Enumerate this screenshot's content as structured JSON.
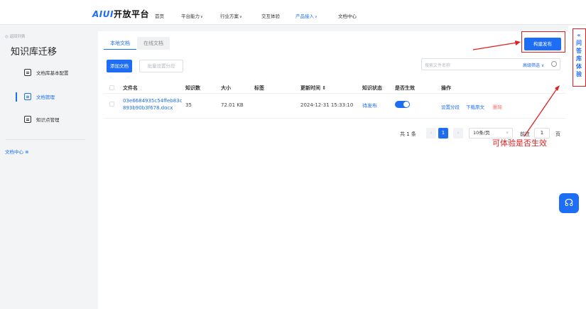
{
  "header": {
    "logo_prefix": "AIUI",
    "logo_text": "开放平台",
    "nav": [
      {
        "label": "首页"
      },
      {
        "label": "平台能力",
        "chevron": "chevron-down-icon"
      },
      {
        "label": "行业方案",
        "chevron": "chevron-down-icon"
      },
      {
        "label": "交互体验"
      },
      {
        "label": "产品接入",
        "chevron": "chevron-down-icon",
        "active": true
      },
      {
        "label": "文档中心"
      }
    ]
  },
  "sidebar": {
    "back_label": "◎ 返回列表",
    "title": "知识库迁移",
    "items": [
      {
        "label": "文档库基本配置",
        "icon": "config-doc-icon"
      },
      {
        "label": "文档管理",
        "icon": "doc-manage-icon",
        "active": true
      },
      {
        "label": "知识点管理",
        "icon": "book-icon"
      }
    ],
    "doc_center_label": "文档中心 ⊗"
  },
  "main": {
    "tabs": [
      {
        "label": "本地文档",
        "active": true
      },
      {
        "label": "在线文档"
      }
    ],
    "add_button": "添加文档",
    "batch_button": "批量设置分段",
    "build_button": "构建发布",
    "help_icon": "?",
    "search": {
      "placeholder": "搜索文件名称",
      "advanced": "高级筛选 ∨"
    },
    "table": {
      "columns": [
        "文件名",
        "知识数",
        "大小",
        "标签",
        "更新时间 ⇕",
        "知识状态",
        "是否生效",
        "操作"
      ],
      "rows": [
        {
          "file_name_1": "03e6684935c54ffeb83c",
          "file_name_2": "893b90b3f678.docx",
          "knowledge_count": "35",
          "size": "72.01 KB",
          "tag": "",
          "updated": "2024-12-31 15:33:10",
          "status": "待发布",
          "effective": true,
          "actions": {
            "set_segment": "设置分段",
            "download": "下载原文",
            "delete": "删除"
          }
        }
      ]
    },
    "pagination": {
      "total": "共 1 条",
      "prev": "‹",
      "current": "1",
      "next": "›",
      "page_size": "10条/页",
      "goto_prefix": "前往",
      "goto_value": "1",
      "goto_suffix": "页"
    }
  },
  "annotation": {
    "text": "可体验是否生效"
  },
  "right_panel": {
    "chars": "«\n问\n答\n库\n体\n验"
  },
  "colors": {
    "accent": "#1d6ef5",
    "annotation": "#e02020",
    "delete": "#f56c6c"
  }
}
